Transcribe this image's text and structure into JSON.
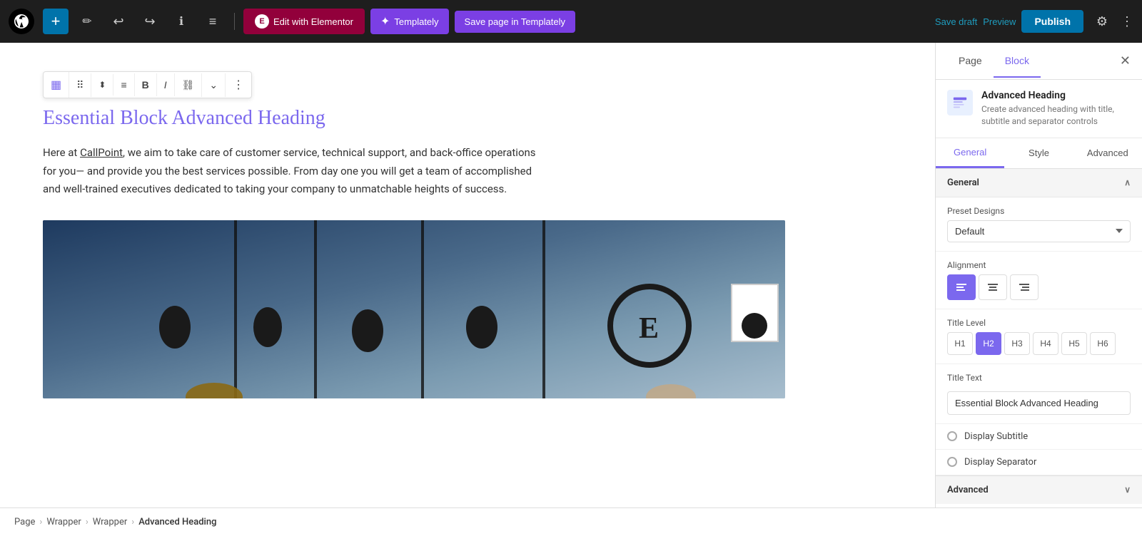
{
  "toolbar": {
    "add_label": "+",
    "wp_logo_alt": "WordPress",
    "undo_icon": "↩",
    "redo_icon": "↪",
    "info_icon": "ℹ",
    "list_icon": "≡",
    "edit_elementor_label": "Edit with Elementor",
    "templately_label": "Templately",
    "save_templately_label": "Save page in Templately",
    "save_draft_label": "Save draft",
    "preview_label": "Preview",
    "publish_label": "Publish",
    "settings_icon": "⚙",
    "more_icon": "⋮"
  },
  "block_toolbar": {
    "icon1": "▦",
    "icon2": "⠿",
    "icon3": "⌃",
    "icon4": "≡",
    "bold": "B",
    "italic": "I",
    "link": "⛓",
    "chevron": "⌄",
    "more": "⋮"
  },
  "editor": {
    "heading": "Essential Block Advanced Heading",
    "body_text_line1": "Here at ",
    "body_link": "CallPoint",
    "body_text_rest": ", we aim to take care of customer service, technical support, and back-office operations for you— and provide you the best services possible. From day one you will get a team of accomplished and well-trained executives dedicated to taking your company to unmatchable heights of success."
  },
  "right_panel": {
    "tab_page": "Page",
    "tab_block": "Block",
    "close_icon": "✕",
    "block_title": "Advanced Heading",
    "block_desc": "Create advanced heading with title, subtitle and separator controls",
    "subtab_general": "General",
    "subtab_style": "Style",
    "subtab_advanced": "Advanced",
    "section_general_label": "General",
    "preset_designs_label": "Preset Designs",
    "preset_designs_value": "Default",
    "alignment_label": "Alignment",
    "align_left": "≡",
    "align_center": "≡",
    "align_right": "≡",
    "title_level_label": "Title Level",
    "levels": [
      "H1",
      "H2",
      "H3",
      "H4",
      "H5",
      "H6"
    ],
    "active_level": "H2",
    "title_text_label": "Title Text",
    "title_text_value": "Essential Block Advanced Heading",
    "display_subtitle_label": "Display Subtitle",
    "display_separator_label": "Display Separator",
    "section_advanced_label": "Advanced"
  },
  "breadcrumb": {
    "items": [
      "Page",
      "Wrapper",
      "Wrapper",
      "Advanced Heading"
    ]
  }
}
